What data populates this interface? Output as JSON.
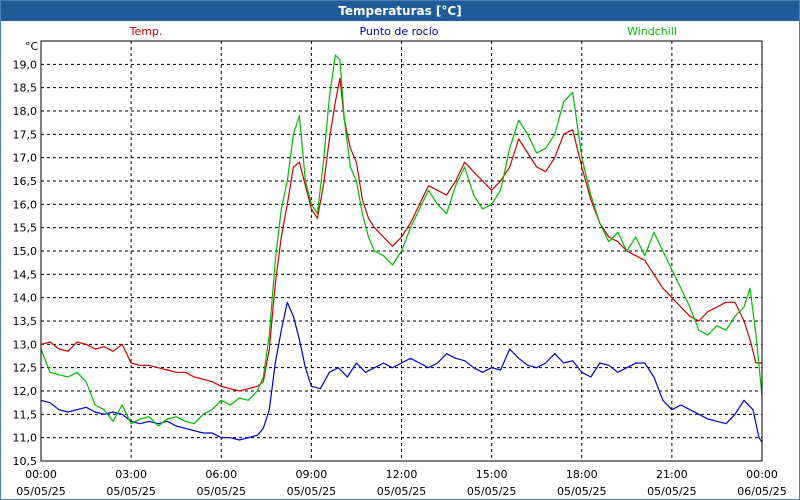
{
  "window": {
    "title": "Temperaturas [°C]"
  },
  "chart_data": {
    "type": "line",
    "title": "Temperaturas [°C]",
    "ylabel": "°C",
    "xlabel": "",
    "ylim": [
      10.5,
      19.5
    ],
    "xlim": [
      0,
      24
    ],
    "grid": true,
    "legend_position": "top",
    "y_ticks": [
      "10,5",
      "11,0",
      "11,5",
      "12,0",
      "12,5",
      "13,0",
      "13,5",
      "14,0",
      "14,5",
      "15,0",
      "15,5",
      "16,0",
      "16,5",
      "17,0",
      "17,5",
      "18,0",
      "18,5",
      "19,0"
    ],
    "x_ticks": [
      {
        "time": "00:00",
        "date": "05/05/25"
      },
      {
        "time": "03:00",
        "date": "05/05/25"
      },
      {
        "time": "06:00",
        "date": "05/05/25"
      },
      {
        "time": "09:00",
        "date": "05/05/25"
      },
      {
        "time": "12:00",
        "date": "05/05/25"
      },
      {
        "time": "15:00",
        "date": "05/05/25"
      },
      {
        "time": "18:00",
        "date": "05/05/25"
      },
      {
        "time": "21:00",
        "date": "05/05/25"
      },
      {
        "time": "00:00",
        "date": "06/05/25"
      }
    ],
    "series": [
      {
        "name": "Temp.",
        "color": "#cc0000",
        "points": [
          [
            0,
            13.0
          ],
          [
            0.3,
            13.05
          ],
          [
            0.6,
            12.9
          ],
          [
            0.9,
            12.85
          ],
          [
            1.2,
            13.05
          ],
          [
            1.5,
            13.0
          ],
          [
            1.8,
            12.9
          ],
          [
            2.1,
            12.95
          ],
          [
            2.4,
            12.85
          ],
          [
            2.7,
            13.0
          ],
          [
            3.0,
            12.6
          ],
          [
            3.3,
            12.55
          ],
          [
            3.6,
            12.55
          ],
          [
            3.9,
            12.5
          ],
          [
            4.2,
            12.45
          ],
          [
            4.5,
            12.4
          ],
          [
            4.8,
            12.4
          ],
          [
            5.1,
            12.3
          ],
          [
            5.4,
            12.25
          ],
          [
            5.7,
            12.2
          ],
          [
            6.0,
            12.1
          ],
          [
            6.3,
            12.05
          ],
          [
            6.6,
            12.0
          ],
          [
            6.9,
            12.05
          ],
          [
            7.2,
            12.1
          ],
          [
            7.4,
            12.2
          ],
          [
            7.6,
            12.9
          ],
          [
            7.8,
            14.3
          ],
          [
            8.0,
            15.3
          ],
          [
            8.2,
            16.0
          ],
          [
            8.4,
            16.8
          ],
          [
            8.6,
            16.9
          ],
          [
            8.8,
            16.4
          ],
          [
            9.0,
            15.9
          ],
          [
            9.2,
            15.7
          ],
          [
            9.4,
            16.4
          ],
          [
            9.6,
            17.4
          ],
          [
            9.8,
            18.2
          ],
          [
            9.95,
            18.7
          ],
          [
            10.1,
            17.8
          ],
          [
            10.3,
            17.2
          ],
          [
            10.5,
            16.9
          ],
          [
            10.7,
            16.1
          ],
          [
            10.9,
            15.7
          ],
          [
            11.1,
            15.5
          ],
          [
            11.4,
            15.3
          ],
          [
            11.7,
            15.1
          ],
          [
            12.0,
            15.3
          ],
          [
            12.3,
            15.6
          ],
          [
            12.6,
            16.0
          ],
          [
            12.9,
            16.4
          ],
          [
            13.2,
            16.3
          ],
          [
            13.5,
            16.2
          ],
          [
            13.8,
            16.5
          ],
          [
            14.1,
            16.9
          ],
          [
            14.4,
            16.7
          ],
          [
            14.7,
            16.5
          ],
          [
            15.0,
            16.3
          ],
          [
            15.3,
            16.5
          ],
          [
            15.6,
            16.8
          ],
          [
            15.9,
            17.4
          ],
          [
            16.2,
            17.1
          ],
          [
            16.5,
            16.8
          ],
          [
            16.8,
            16.7
          ],
          [
            17.1,
            17.0
          ],
          [
            17.4,
            17.5
          ],
          [
            17.7,
            17.6
          ],
          [
            18.0,
            16.8
          ],
          [
            18.3,
            16.1
          ],
          [
            18.6,
            15.6
          ],
          [
            18.9,
            15.3
          ],
          [
            19.2,
            15.2
          ],
          [
            19.5,
            15.0
          ],
          [
            19.8,
            14.9
          ],
          [
            20.1,
            14.8
          ],
          [
            20.4,
            14.5
          ],
          [
            20.7,
            14.2
          ],
          [
            21.0,
            14.0
          ],
          [
            21.3,
            13.8
          ],
          [
            21.6,
            13.6
          ],
          [
            21.9,
            13.5
          ],
          [
            22.2,
            13.7
          ],
          [
            22.5,
            13.8
          ],
          [
            22.8,
            13.9
          ],
          [
            23.1,
            13.9
          ],
          [
            23.4,
            13.5
          ],
          [
            23.6,
            13.1
          ],
          [
            23.8,
            12.6
          ],
          [
            24.0,
            12.6
          ]
        ]
      },
      {
        "name": "Punto de rocío",
        "color": "#0000cc",
        "points": [
          [
            0,
            11.8
          ],
          [
            0.3,
            11.75
          ],
          [
            0.6,
            11.6
          ],
          [
            0.9,
            11.55
          ],
          [
            1.2,
            11.6
          ],
          [
            1.5,
            11.65
          ],
          [
            1.8,
            11.55
          ],
          [
            2.1,
            11.5
          ],
          [
            2.4,
            11.55
          ],
          [
            2.7,
            11.5
          ],
          [
            3.0,
            11.35
          ],
          [
            3.3,
            11.3
          ],
          [
            3.6,
            11.35
          ],
          [
            3.9,
            11.3
          ],
          [
            4.2,
            11.35
          ],
          [
            4.5,
            11.25
          ],
          [
            4.8,
            11.2
          ],
          [
            5.1,
            11.15
          ],
          [
            5.4,
            11.1
          ],
          [
            5.7,
            11.1
          ],
          [
            6.0,
            11.0
          ],
          [
            6.3,
            11.0
          ],
          [
            6.6,
            10.95
          ],
          [
            6.9,
            11.0
          ],
          [
            7.2,
            11.05
          ],
          [
            7.4,
            11.2
          ],
          [
            7.6,
            11.6
          ],
          [
            7.8,
            12.6
          ],
          [
            8.0,
            13.3
          ],
          [
            8.2,
            13.9
          ],
          [
            8.4,
            13.6
          ],
          [
            8.6,
            13.1
          ],
          [
            8.8,
            12.5
          ],
          [
            9.0,
            12.1
          ],
          [
            9.3,
            12.05
          ],
          [
            9.6,
            12.4
          ],
          [
            9.9,
            12.5
          ],
          [
            10.2,
            12.3
          ],
          [
            10.5,
            12.6
          ],
          [
            10.8,
            12.4
          ],
          [
            11.1,
            12.5
          ],
          [
            11.4,
            12.6
          ],
          [
            11.7,
            12.5
          ],
          [
            12.0,
            12.6
          ],
          [
            12.3,
            12.7
          ],
          [
            12.6,
            12.6
          ],
          [
            12.9,
            12.5
          ],
          [
            13.2,
            12.6
          ],
          [
            13.5,
            12.8
          ],
          [
            13.8,
            12.7
          ],
          [
            14.1,
            12.65
          ],
          [
            14.4,
            12.5
          ],
          [
            14.7,
            12.4
          ],
          [
            15.0,
            12.5
          ],
          [
            15.3,
            12.45
          ],
          [
            15.6,
            12.9
          ],
          [
            15.9,
            12.7
          ],
          [
            16.2,
            12.55
          ],
          [
            16.5,
            12.5
          ],
          [
            16.8,
            12.6
          ],
          [
            17.1,
            12.8
          ],
          [
            17.4,
            12.6
          ],
          [
            17.7,
            12.65
          ],
          [
            18.0,
            12.4
          ],
          [
            18.3,
            12.3
          ],
          [
            18.6,
            12.6
          ],
          [
            18.9,
            12.55
          ],
          [
            19.2,
            12.4
          ],
          [
            19.5,
            12.5
          ],
          [
            19.8,
            12.6
          ],
          [
            20.1,
            12.6
          ],
          [
            20.4,
            12.3
          ],
          [
            20.7,
            11.8
          ],
          [
            21.0,
            11.6
          ],
          [
            21.3,
            11.7
          ],
          [
            21.6,
            11.6
          ],
          [
            21.9,
            11.5
          ],
          [
            22.2,
            11.4
          ],
          [
            22.5,
            11.35
          ],
          [
            22.8,
            11.3
          ],
          [
            23.1,
            11.5
          ],
          [
            23.4,
            11.8
          ],
          [
            23.7,
            11.6
          ],
          [
            23.9,
            11.0
          ],
          [
            24.0,
            10.9
          ]
        ]
      },
      {
        "name": "Windchill",
        "color": "#00bb00",
        "points": [
          [
            0,
            12.9
          ],
          [
            0.3,
            12.4
          ],
          [
            0.6,
            12.35
          ],
          [
            0.9,
            12.3
          ],
          [
            1.2,
            12.4
          ],
          [
            1.5,
            12.2
          ],
          [
            1.8,
            11.7
          ],
          [
            2.1,
            11.6
          ],
          [
            2.4,
            11.35
          ],
          [
            2.7,
            11.7
          ],
          [
            3.0,
            11.3
          ],
          [
            3.3,
            11.4
          ],
          [
            3.6,
            11.45
          ],
          [
            3.9,
            11.25
          ],
          [
            4.2,
            11.4
          ],
          [
            4.5,
            11.45
          ],
          [
            4.8,
            11.35
          ],
          [
            5.1,
            11.3
          ],
          [
            5.4,
            11.5
          ],
          [
            5.7,
            11.6
          ],
          [
            6.0,
            11.8
          ],
          [
            6.3,
            11.7
          ],
          [
            6.6,
            11.85
          ],
          [
            6.9,
            11.8
          ],
          [
            7.2,
            12.0
          ],
          [
            7.4,
            12.3
          ],
          [
            7.6,
            13.2
          ],
          [
            7.8,
            14.8
          ],
          [
            8.0,
            15.9
          ],
          [
            8.2,
            16.5
          ],
          [
            8.4,
            17.5
          ],
          [
            8.6,
            17.9
          ],
          [
            8.8,
            16.5
          ],
          [
            9.0,
            16.0
          ],
          [
            9.2,
            15.8
          ],
          [
            9.4,
            16.9
          ],
          [
            9.6,
            18.3
          ],
          [
            9.8,
            19.2
          ],
          [
            9.95,
            19.1
          ],
          [
            10.1,
            17.8
          ],
          [
            10.3,
            16.8
          ],
          [
            10.5,
            16.5
          ],
          [
            10.7,
            15.8
          ],
          [
            10.9,
            15.3
          ],
          [
            11.1,
            15.0
          ],
          [
            11.4,
            14.9
          ],
          [
            11.7,
            14.7
          ],
          [
            12.0,
            15.0
          ],
          [
            12.3,
            15.5
          ],
          [
            12.6,
            15.9
          ],
          [
            12.9,
            16.3
          ],
          [
            13.2,
            16.0
          ],
          [
            13.5,
            15.8
          ],
          [
            13.8,
            16.4
          ],
          [
            14.1,
            16.8
          ],
          [
            14.4,
            16.2
          ],
          [
            14.7,
            15.9
          ],
          [
            15.0,
            16.0
          ],
          [
            15.3,
            16.3
          ],
          [
            15.6,
            17.2
          ],
          [
            15.9,
            17.8
          ],
          [
            16.2,
            17.5
          ],
          [
            16.5,
            17.1
          ],
          [
            16.8,
            17.2
          ],
          [
            17.1,
            17.5
          ],
          [
            17.4,
            18.2
          ],
          [
            17.7,
            18.4
          ],
          [
            18.0,
            17.0
          ],
          [
            18.3,
            16.2
          ],
          [
            18.6,
            15.6
          ],
          [
            18.9,
            15.2
          ],
          [
            19.2,
            15.4
          ],
          [
            19.5,
            15.0
          ],
          [
            19.8,
            15.3
          ],
          [
            20.1,
            14.9
          ],
          [
            20.4,
            15.4
          ],
          [
            20.7,
            15.0
          ],
          [
            21.0,
            14.6
          ],
          [
            21.3,
            14.2
          ],
          [
            21.6,
            13.8
          ],
          [
            21.9,
            13.3
          ],
          [
            22.2,
            13.2
          ],
          [
            22.5,
            13.4
          ],
          [
            22.8,
            13.3
          ],
          [
            23.1,
            13.6
          ],
          [
            23.4,
            13.8
          ],
          [
            23.6,
            14.2
          ],
          [
            23.8,
            13.2
          ],
          [
            24.0,
            11.9
          ]
        ]
      }
    ]
  }
}
